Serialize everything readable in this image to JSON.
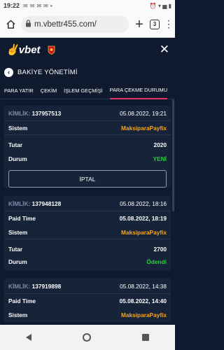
{
  "status_bar": {
    "time": "19:22",
    "notifications": [
      "✉",
      "✉",
      "✉",
      "✉",
      "•"
    ],
    "right_icons": "⏰ ▾ ▅ ▮"
  },
  "browser": {
    "url": "m.vbettr455.com/",
    "tab_count": "3"
  },
  "app": {
    "logo_v": "✌",
    "logo_text": "vbet",
    "page_title": "BAKİYE YÖNETİMİ",
    "tabs": [
      {
        "label": "PARA YATIR"
      },
      {
        "label": "ÇEKİM"
      },
      {
        "label": "İŞLEM GEÇMİŞİ"
      },
      {
        "label": "PARA ÇEKME DURUMU"
      }
    ]
  },
  "withdrawals": [
    {
      "id_label": "KİMLİK:",
      "id": "137957513",
      "date": "05.08.2022, 19:21",
      "system_label": "Sistem",
      "system": "MaksiparaPayfix",
      "amount_label": "Tutar",
      "amount": "2020",
      "status_label": "Durum",
      "status": "YENİ",
      "cancel_label": "İPTAL"
    },
    {
      "id_label": "KİMLİK:",
      "id": "137948128",
      "date": "05.08.2022, 18:16",
      "paid_label": "Paid Time",
      "paid_time": "05.08.2022, 18:19",
      "system_label": "Sistem",
      "system": "MaksiparaPayfix",
      "amount_label": "Tutar",
      "amount": "2700",
      "status_label": "Durum",
      "status": "Ödendi"
    },
    {
      "id_label": "KİMLİK:",
      "id": "137919898",
      "date": "05.08.2022, 14:38",
      "paid_label": "Paid Time",
      "paid_time": "05.08.2022, 14:40",
      "system_label": "Sistem",
      "system": "MaksiparaPayfix"
    }
  ],
  "colors": {
    "background": "#0f1a2e",
    "card": "#162339",
    "accent": "#e6336e",
    "system_text": "#f5a623",
    "status_green": "#2ecc40"
  }
}
